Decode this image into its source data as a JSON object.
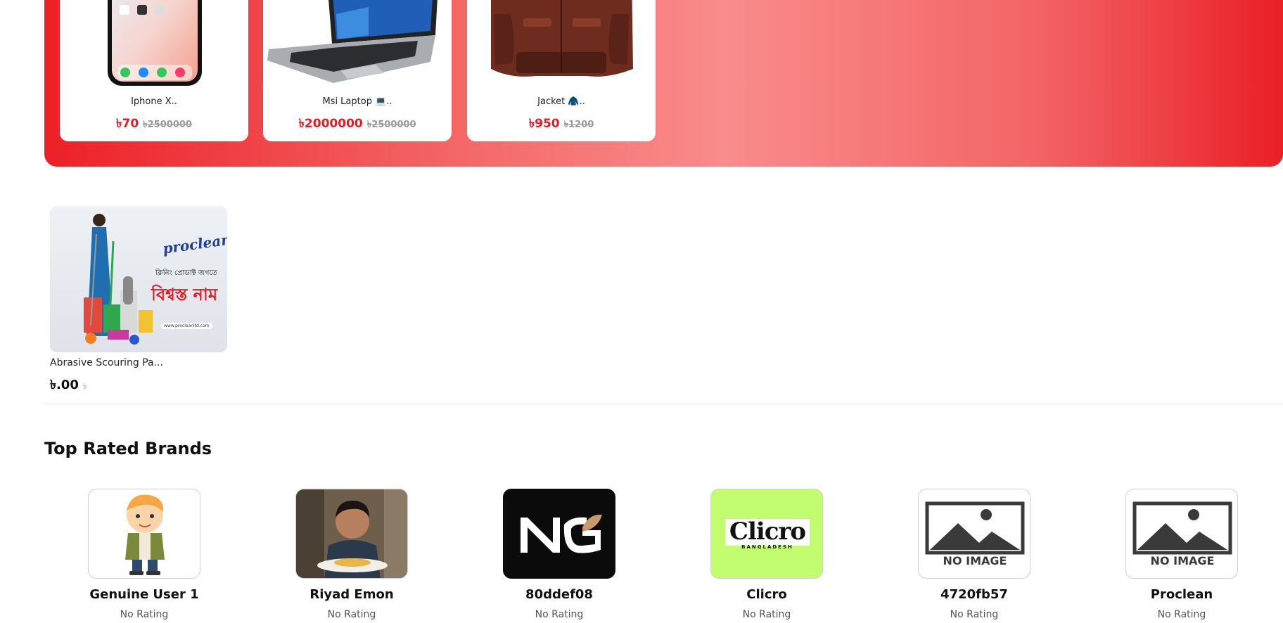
{
  "flash_sale": {
    "items": [
      {
        "name": "Iphone X..",
        "price": "৳70",
        "old_price": "৳2500000"
      },
      {
        "name": "Msi Laptop 💻..",
        "price": "৳2000000",
        "old_price": "৳2500000"
      },
      {
        "name": "Jacket 🧥..",
        "price": "৳950",
        "old_price": "৳1200"
      }
    ]
  },
  "product": {
    "image_text_brand": "proclean",
    "image_text_line1": "ক্লিনিং প্রোডাক্ট জগতে",
    "image_text_line2": "বিশ্বস্ত নাম",
    "image_text_url": "www.procleanltd.com",
    "title": "Abrasive Scouring Pa...",
    "price": "৳.00",
    "old_price": "৳"
  },
  "brands_section": {
    "title": "Top Rated Brands",
    "no_image_label": "NO IMAGE",
    "brands": [
      {
        "name": "Genuine User 1",
        "rating": "No Rating"
      },
      {
        "name": "Riyad Emon",
        "rating": "No Rating"
      },
      {
        "name": "80ddef08",
        "rating": "No Rating"
      },
      {
        "name": "Clicro",
        "rating": "No Rating",
        "logo_text": "Clicro",
        "logo_sub": "BANGLADESH"
      },
      {
        "name": "4720fb57",
        "rating": "No Rating"
      },
      {
        "name": "Proclean",
        "rating": "No Rating"
      }
    ]
  },
  "colors": {
    "accent": "#e21d25",
    "banner_light": "#f98c8c",
    "clicro_bg": "#c2fc6f"
  }
}
